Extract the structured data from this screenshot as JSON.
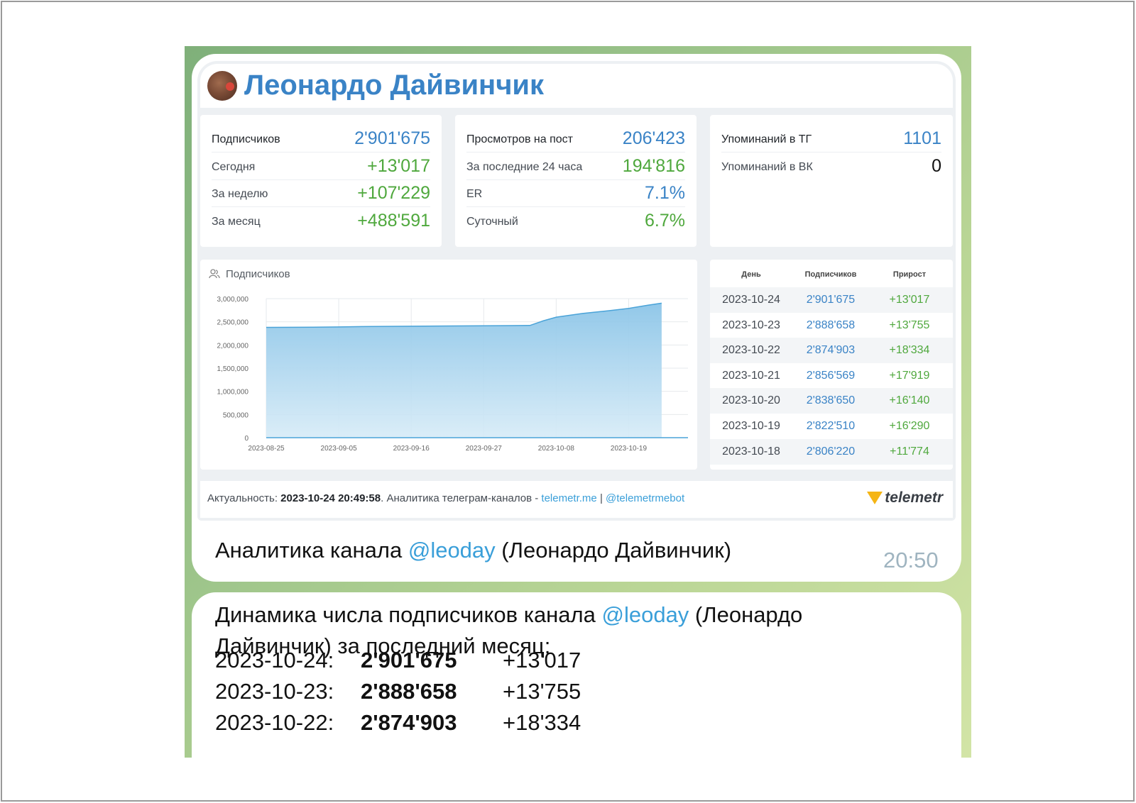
{
  "channel": {
    "title": "Леонардо Дайвинчик"
  },
  "stats": {
    "subscribers": [
      {
        "label": "Подписчиков",
        "value": "2'901'675",
        "color": "blue"
      },
      {
        "label": "Сегодня",
        "value": "+13'017",
        "color": "green"
      },
      {
        "label": "За неделю",
        "value": "+107'229",
        "color": "green"
      },
      {
        "label": "За месяц",
        "value": "+488'591",
        "color": "green"
      }
    ],
    "views": [
      {
        "label": "Просмотров на пост",
        "value": "206'423",
        "color": "blue"
      },
      {
        "label": "За последние 24 часа",
        "value": "194'816",
        "color": "green"
      },
      {
        "label": "ER",
        "value": "7.1%",
        "color": "blue"
      },
      {
        "label": "Суточный",
        "value": "6.7%",
        "color": "green"
      }
    ],
    "mentions": [
      {
        "label": "Упоминаний в ТГ",
        "value": "1101",
        "color": "blue"
      },
      {
        "label": "Упоминаний в ВК",
        "value": "0",
        "color": "black"
      }
    ]
  },
  "chart_data": {
    "type": "area",
    "title": "Подписчиков",
    "xlabel": "",
    "ylabel": "",
    "x_tick_labels": [
      "2023-08-25",
      "2023-09-05",
      "2023-09-16",
      "2023-09-27",
      "2023-10-08",
      "2023-10-19"
    ],
    "y_tick_labels": [
      "3,000,000",
      "2,500,000",
      "2,000,000",
      "1,500,000",
      "1,000,000",
      "500,000",
      "0"
    ],
    "ylim": [
      0,
      3000000
    ],
    "grid": true,
    "colors": {
      "fill": "#a9d3ec",
      "line": "#4aa3d8"
    },
    "x": [
      "2023-08-25",
      "2023-09-01",
      "2023-09-05",
      "2023-09-10",
      "2023-09-16",
      "2023-09-22",
      "2023-09-27",
      "2023-10-01",
      "2023-10-04",
      "2023-10-06",
      "2023-10-08",
      "2023-10-12",
      "2023-10-16",
      "2023-10-19",
      "2023-10-22",
      "2023-10-24"
    ],
    "series": [
      {
        "values": [
          2380000,
          2385000,
          2390000,
          2400000,
          2405000,
          2410000,
          2415000,
          2418000,
          2422000,
          2520000,
          2600000,
          2680000,
          2740000,
          2790000,
          2860000,
          2901675
        ]
      }
    ]
  },
  "daily_table": {
    "headers": [
      "День",
      "Подписчиков",
      "Прирост"
    ],
    "rows": [
      {
        "date": "2023-10-24",
        "subs": "2'901'675",
        "growth": "+13'017"
      },
      {
        "date": "2023-10-23",
        "subs": "2'888'658",
        "growth": "+13'755"
      },
      {
        "date": "2023-10-22",
        "subs": "2'874'903",
        "growth": "+18'334"
      },
      {
        "date": "2023-10-21",
        "subs": "2'856'569",
        "growth": "+17'919"
      },
      {
        "date": "2023-10-20",
        "subs": "2'838'650",
        "growth": "+16'140"
      },
      {
        "date": "2023-10-19",
        "subs": "2'822'510",
        "growth": "+16'290"
      },
      {
        "date": "2023-10-18",
        "subs": "2'806'220",
        "growth": "+11'774"
      }
    ]
  },
  "footer": {
    "actuality_label": "Актуальность: ",
    "actuality_value": "2023-10-24 20:49:58",
    "text": ". Аналитика телеграм-каналов - ",
    "link1": "telemetr.me",
    "separator": " | ",
    "link2": "@telemetrmebot",
    "brand": "telemetr"
  },
  "message1": {
    "prefix": "Аналитика канала ",
    "mention": "@leoday",
    "suffix": " (Леонардо Дайвинчик)",
    "time": "20:50"
  },
  "message2": {
    "prefix": "Динамика числа подписчиков канала ",
    "mention": "@leoday",
    "suffix_line1": " (Леонардо",
    "line2": "Дайвинчик) за последний месяц:",
    "rows": [
      {
        "date": "2023-10-24:",
        "subs": "2'901'675",
        "growth": "+13'017"
      },
      {
        "date": "2023-10-23:",
        "subs": "2'888'658",
        "growth": "+13'755"
      },
      {
        "date": "2023-10-22:",
        "subs": "2'874'903",
        "growth": "+18'334"
      }
    ]
  }
}
